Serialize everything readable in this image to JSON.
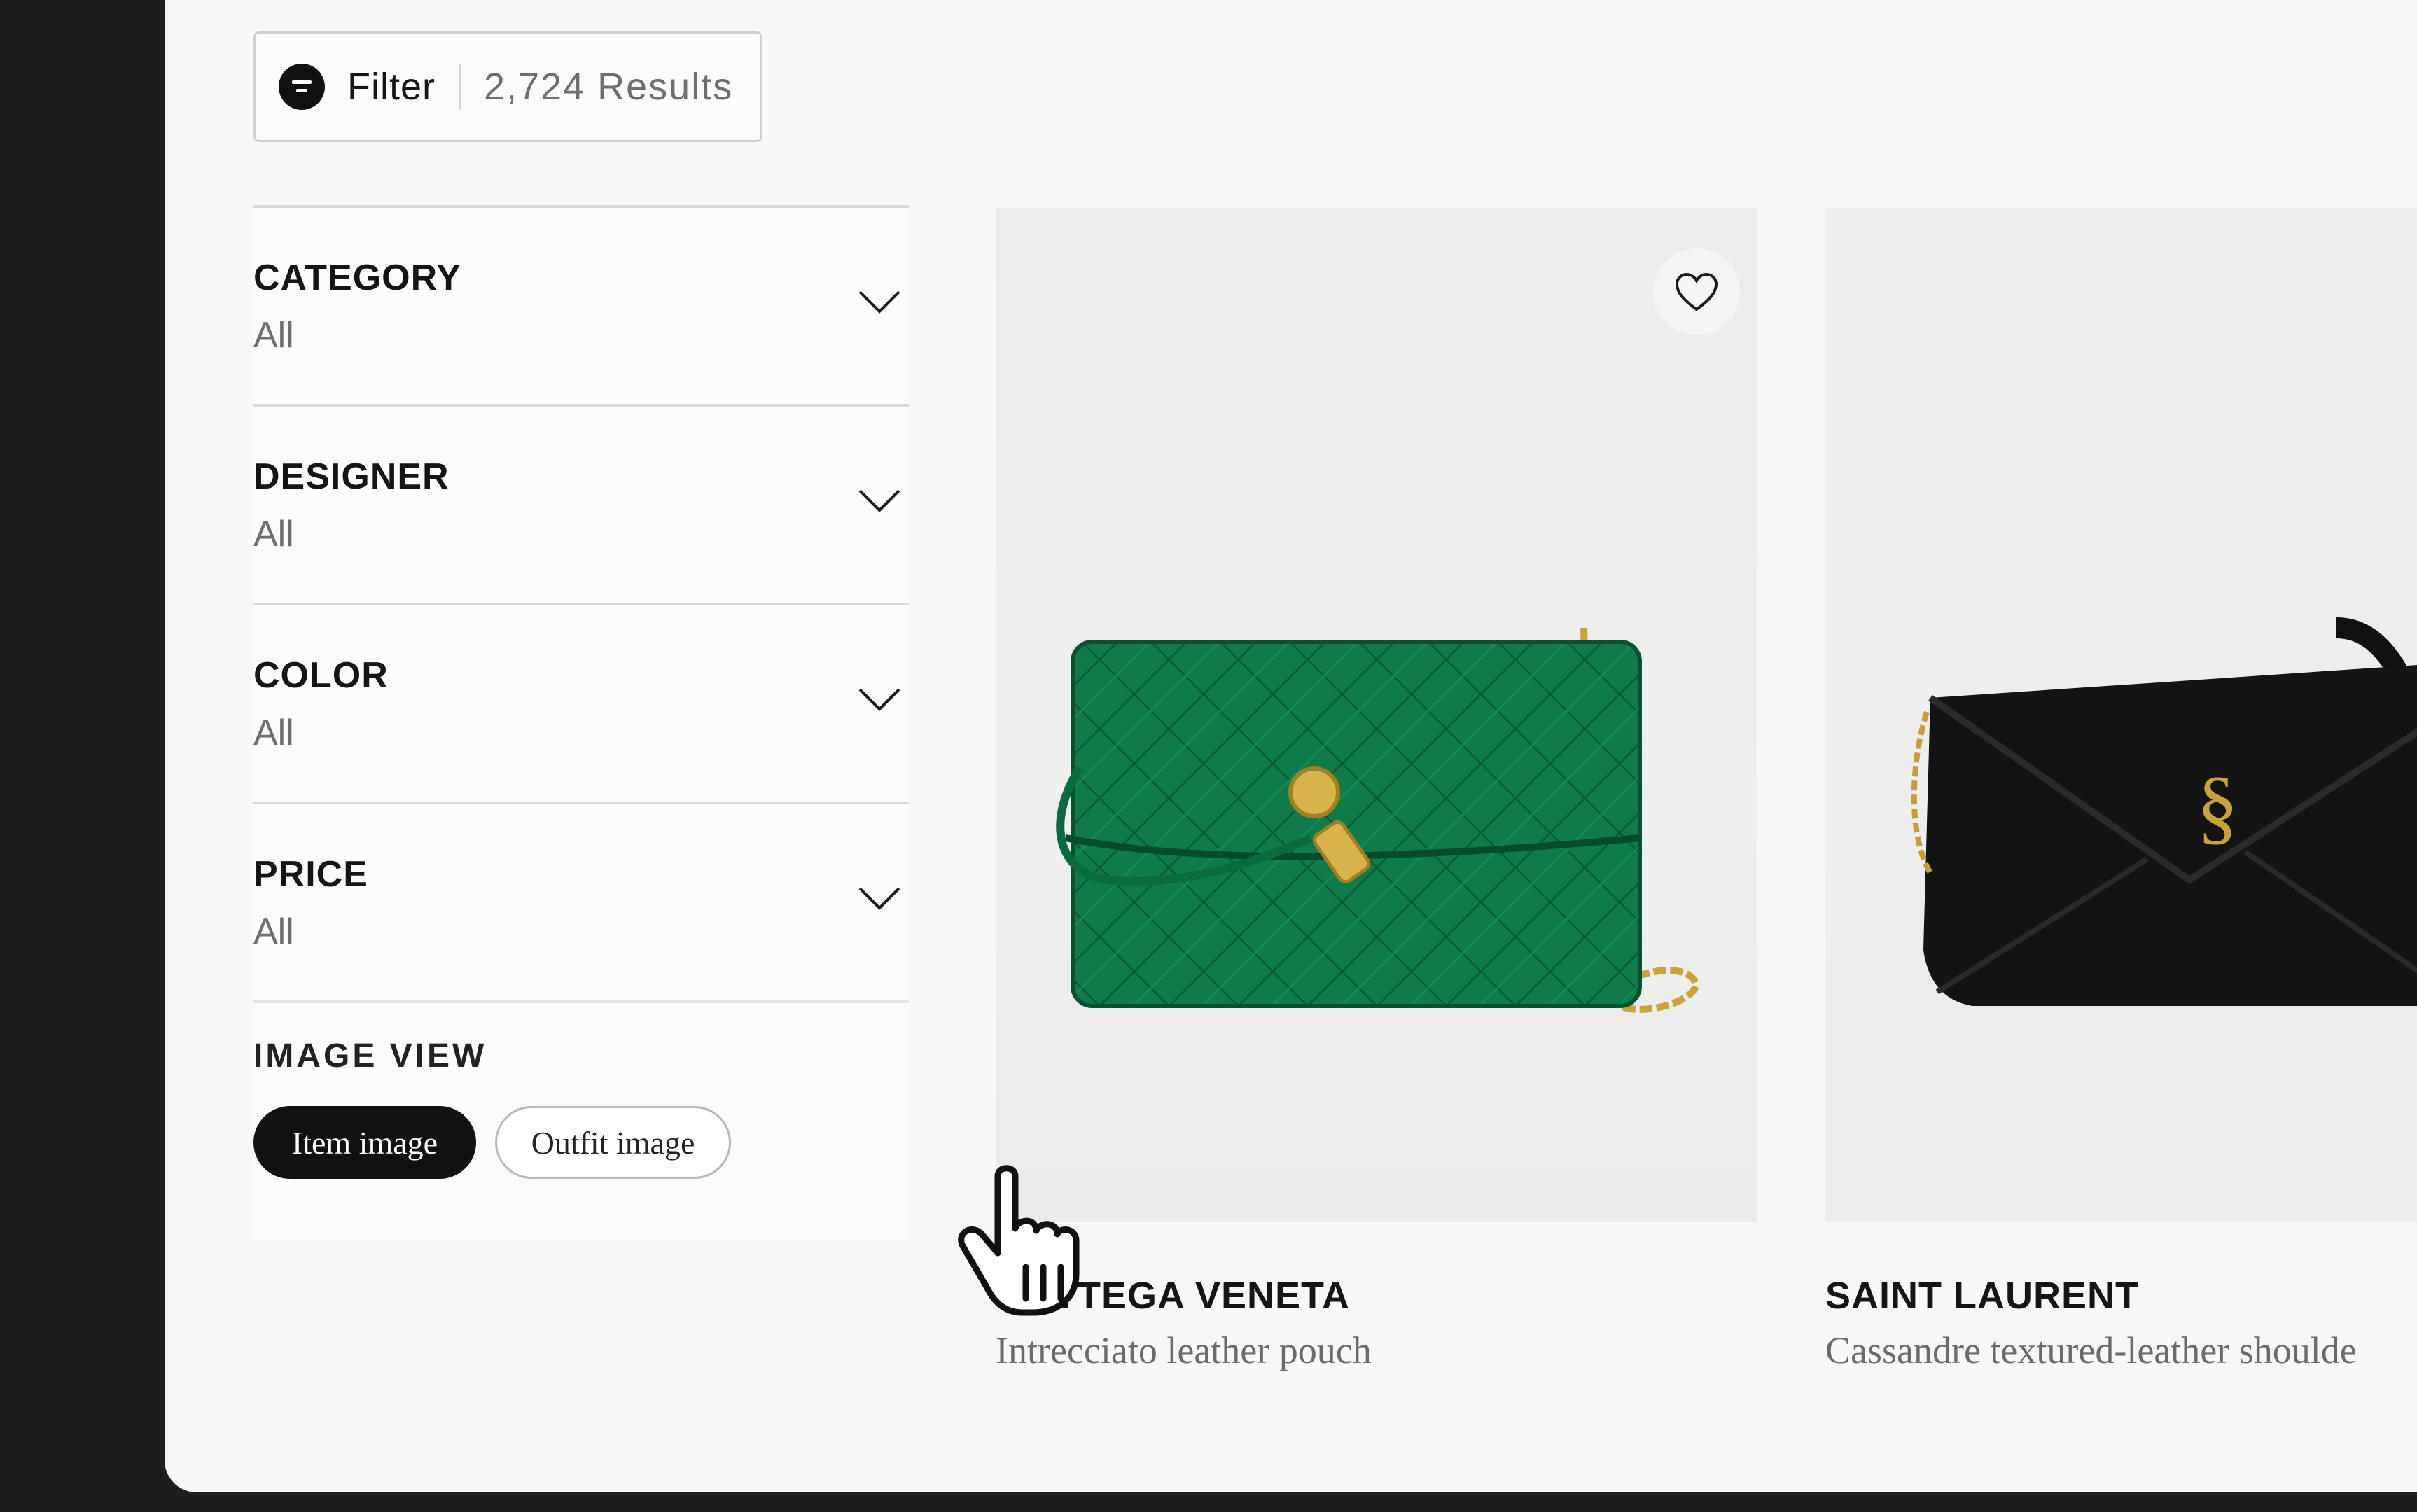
{
  "filter_bar": {
    "label": "Filter",
    "results": "2,724 Results"
  },
  "facets": [
    {
      "title": "CATEGORY",
      "value": "All"
    },
    {
      "title": "DESIGNER",
      "value": "All"
    },
    {
      "title": "COLOR",
      "value": "All"
    },
    {
      "title": "PRICE",
      "value": "All"
    }
  ],
  "image_view": {
    "title": "IMAGE VIEW",
    "options": [
      "Item image",
      "Outfit image"
    ],
    "selected": "Item image"
  },
  "products": [
    {
      "brand": "BOTTEGA VENETA",
      "name": "Intrecciato leather pouch",
      "color": "#0f7a4a"
    },
    {
      "brand": "SAINT LAURENT",
      "name": "Cassandre textured-leather shoulde",
      "color": "#141414"
    }
  ],
  "icons": [
    "filter-icon",
    "chevron-down-icon",
    "heart-icon",
    "hand-pointer-cursor-icon"
  ]
}
